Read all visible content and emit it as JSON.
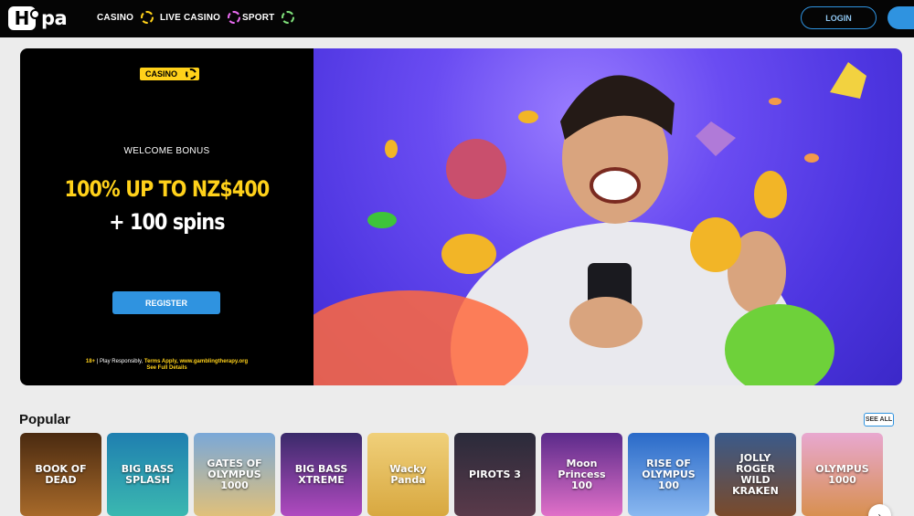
{
  "header": {
    "logo_first": "H",
    "logo_rest": "pa",
    "nav": [
      {
        "label": "CASINO",
        "icon": "casino-chip-icon",
        "color": "#ffd11a"
      },
      {
        "label": "LIVE CASINO",
        "icon": "live-casino-chip-icon",
        "color": "#e86bf0"
      },
      {
        "label": "SPORT",
        "icon": "sport-chip-icon",
        "color": "#7fe07a"
      }
    ],
    "login_label": "LOGIN"
  },
  "hero": {
    "badge": "CASINO",
    "welcome": "WELCOME BONUS",
    "bonus": "100% UP TO NZ$400",
    "spins": "+ 100 spins",
    "register_label": "REGISTER",
    "fineprint_age": "18+",
    "fineprint_mid": " | Play Responsibly, ",
    "fineprint_terms": "Terms Apply, www.gamblingtherapy.org",
    "fineprint_details": "See Full Details"
  },
  "popular": {
    "title": "Popular",
    "see_all": "SEE ALL",
    "games": [
      {
        "name": "BOOK OF DEAD",
        "color": "#7a4a1e"
      },
      {
        "name": "BIG BASS SPLASH",
        "color": "#2a9bb3"
      },
      {
        "name": "GATES OF OLYMPUS 1000",
        "color": "#d9b36a"
      },
      {
        "name": "BIG BASS XTREME",
        "color": "#6b2f8a"
      },
      {
        "name": "Wacky Panda",
        "color": "#e0b84a"
      },
      {
        "name": "PIROTS 3",
        "color": "#3a2a3a"
      },
      {
        "name": "Moon Princess 100",
        "color": "#b14fc4"
      },
      {
        "name": "RISE OF OLYMPUS 100",
        "color": "#4a88d8"
      },
      {
        "name": "JOLLY ROGER WILD KRAKEN",
        "color": "#6b4028"
      },
      {
        "name": "OLYMPUS 1000",
        "color": "#d48ab8"
      }
    ]
  },
  "colors": {
    "accent_blue": "#2f93e0",
    "bonus_yellow": "#ffd11a",
    "hero_purple": "#5a3fe8"
  }
}
